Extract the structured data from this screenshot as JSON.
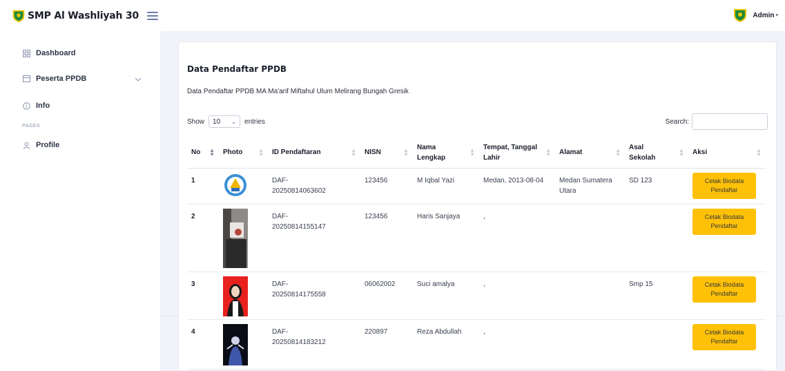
{
  "header": {
    "brand": "SMP Al Washliyah 30",
    "user": "Admin"
  },
  "sidebar": {
    "items": [
      {
        "label": "Dashboard"
      },
      {
        "label": "Peserta PPDB"
      },
      {
        "label": "Info"
      }
    ],
    "section": "PAGES",
    "profile": "Profile"
  },
  "card": {
    "title": "Data Pendaftar PPDB",
    "subtitle": "Data Pendaftar PPDB MA Ma'arif Miftahul Ulum Melirang Bungah Gresik"
  },
  "table_controls": {
    "show": "Show",
    "length_value": "10",
    "entries": "entries",
    "search_label": "Search:"
  },
  "table": {
    "headers": [
      "No",
      "Photo",
      "ID Pendaftaran",
      "NISN",
      "Nama Lengkap",
      "Tempat, Tanggal Lahir",
      "Alamat",
      "Asal Sekolah",
      "Aksi"
    ],
    "rows": [
      {
        "no": "1",
        "id1": "DAF-",
        "id2": "20250814063602",
        "nisn": "123456",
        "nama": "M Iqbal Yazi",
        "ttl": "Medan, 2013-08-04",
        "alamat": "Medan Sumatera Utara",
        "asal": "SD 123",
        "aksi": "Cetak Biodata Pendaftar"
      },
      {
        "no": "2",
        "id1": "DAF-",
        "id2": "20250814155147",
        "nisn": "123456",
        "nama": "Haris Sanjaya",
        "ttl": ",",
        "alamat": "",
        "asal": "",
        "aksi": "Cetak Biodata Pendaftar"
      },
      {
        "no": "3",
        "id1": "DAF-",
        "id2": "20250814175558",
        "nisn": "06062002",
        "nama": "Suci amalya",
        "ttl": ",",
        "alamat": "",
        "asal": "Smp 15",
        "aksi": "Cetak Biodata Pendaftar"
      },
      {
        "no": "4",
        "id1": "DAF-",
        "id2": "20250814183212",
        "nisn": "220897",
        "nama": "Reza Abdullah",
        "ttl": ",",
        "alamat": "",
        "asal": "",
        "aksi": "Cetak Biodata Pendaftar"
      }
    ]
  },
  "colors": {
    "accent": "#ffc107",
    "logo_green": "#1f8a3a",
    "logo_yellow": "#f2c600"
  }
}
